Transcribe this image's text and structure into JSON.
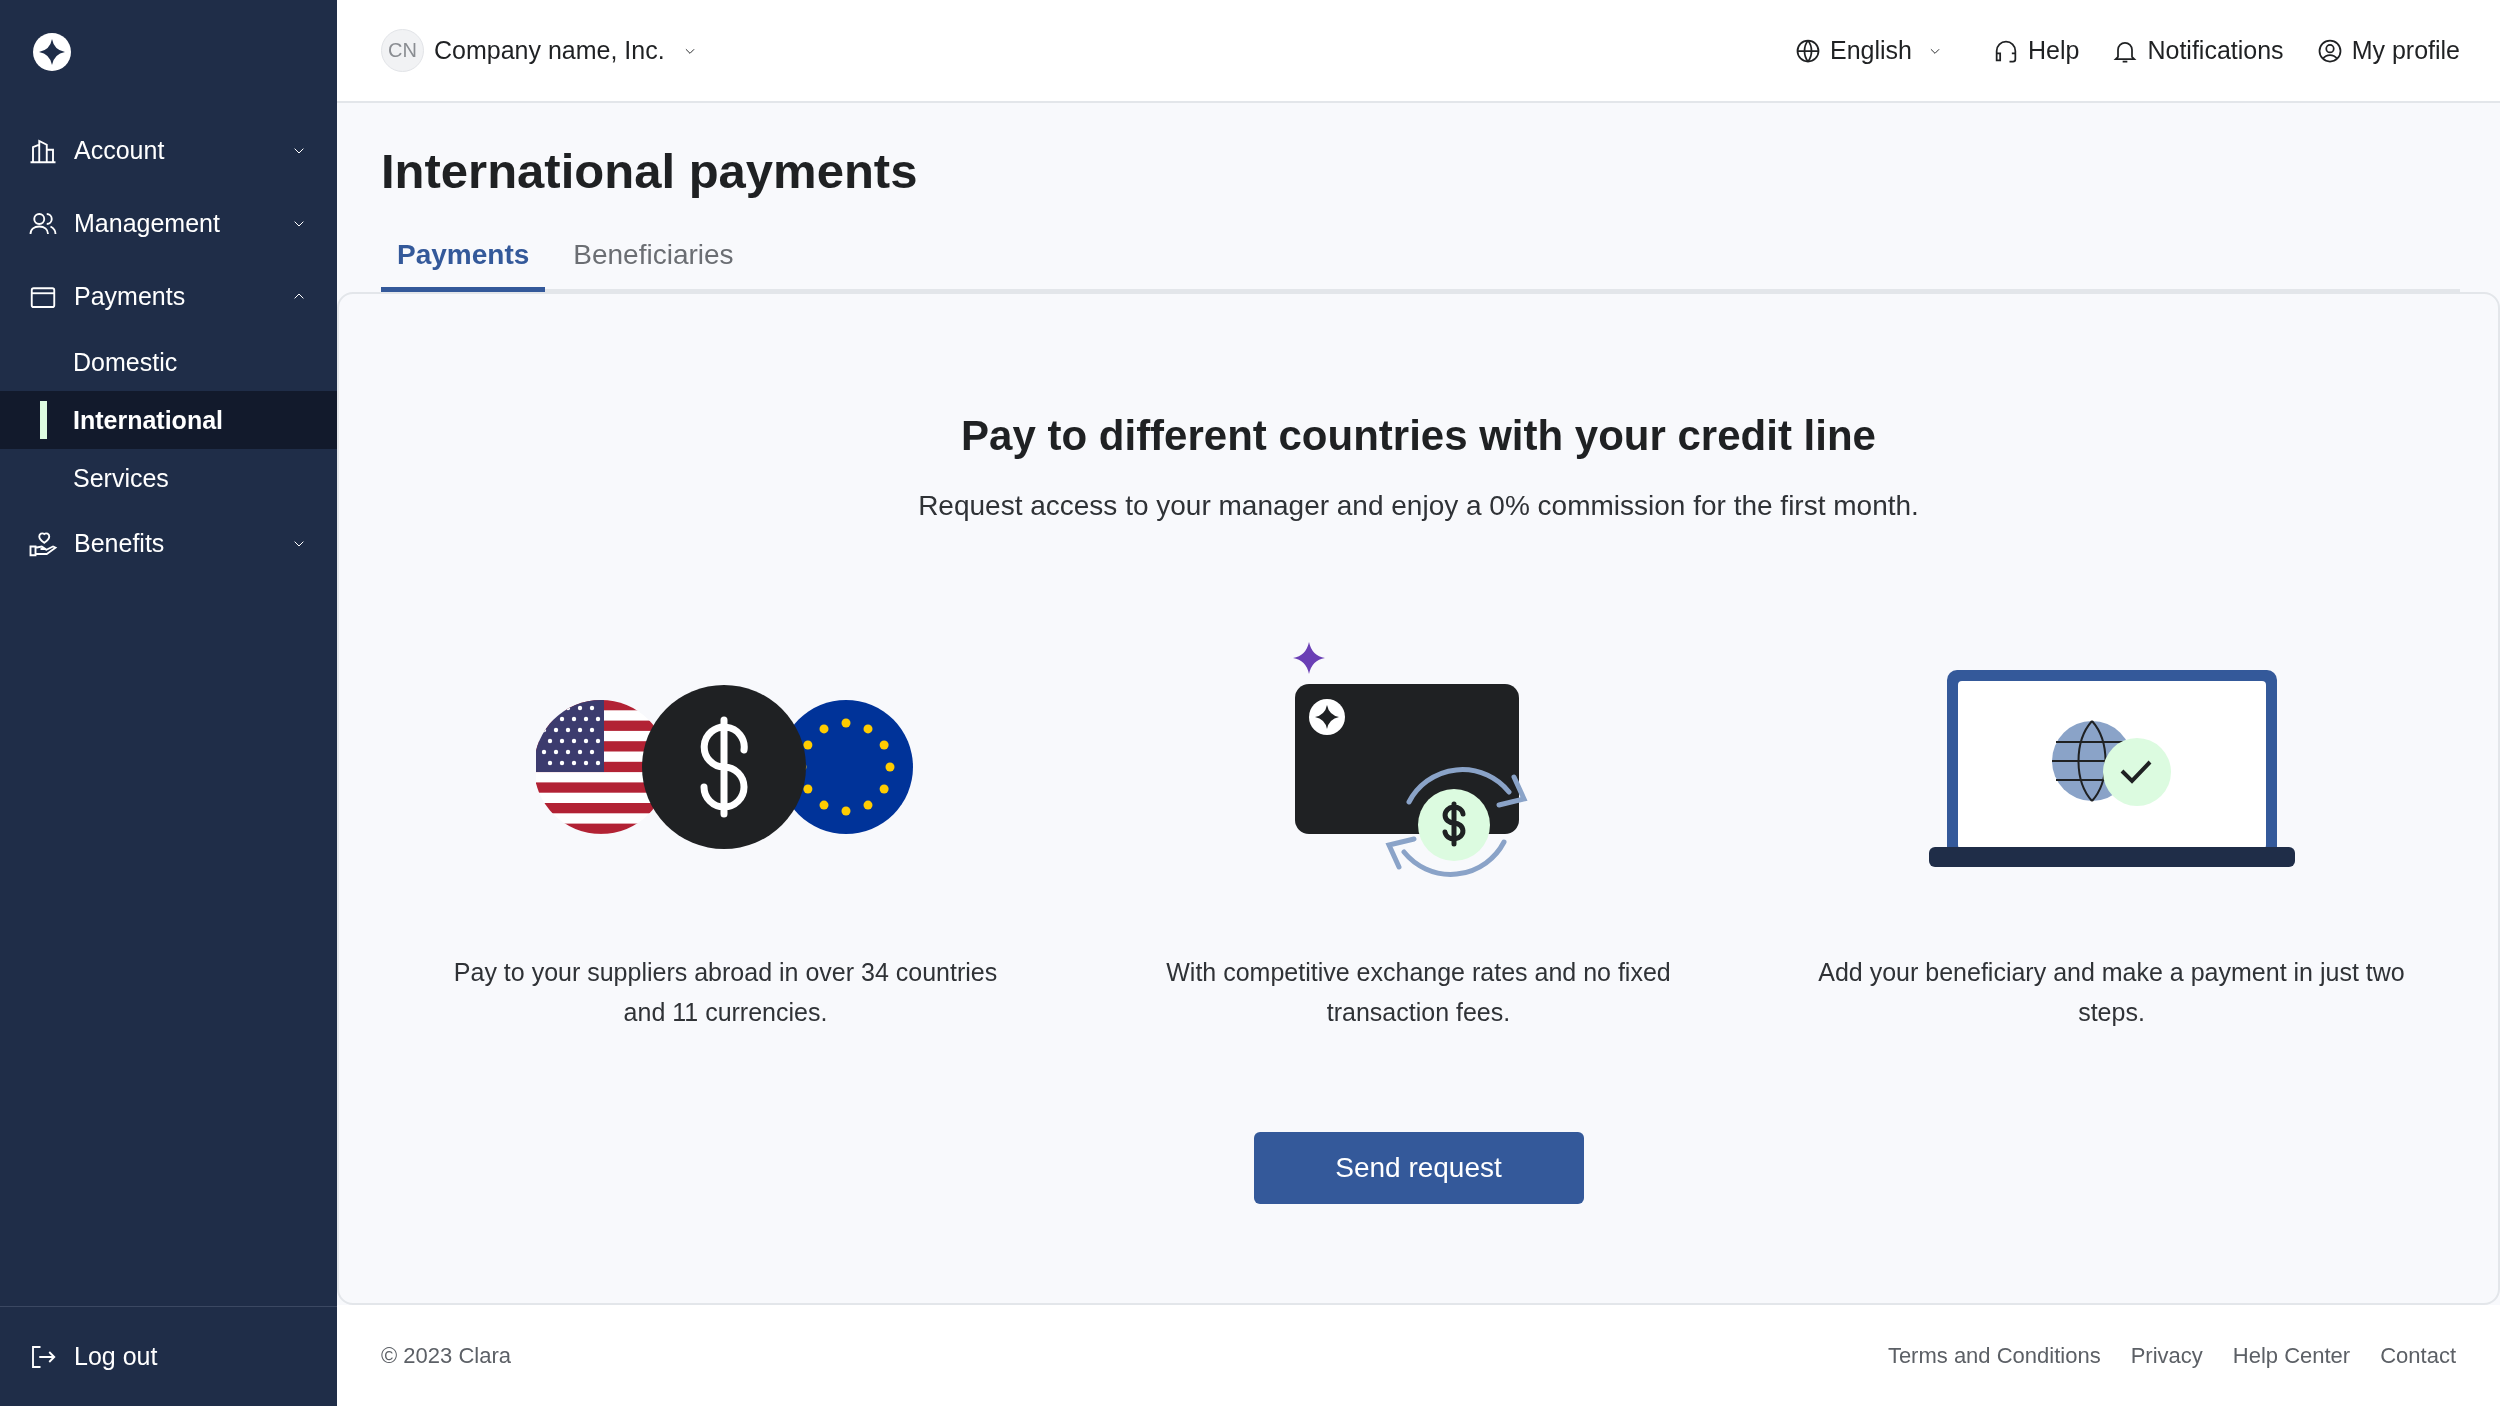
{
  "sidebar": {
    "items": [
      {
        "label": "Account",
        "expanded": false
      },
      {
        "label": "Management",
        "expanded": false
      },
      {
        "label": "Payments",
        "expanded": true,
        "children": [
          {
            "label": "Domestic",
            "selected": false
          },
          {
            "label": "International",
            "selected": true
          },
          {
            "label": "Services",
            "selected": false
          }
        ]
      },
      {
        "label": "Benefits",
        "expanded": false
      }
    ],
    "logout": "Log out"
  },
  "header": {
    "company": {
      "initials": "CN",
      "name": "Company name, Inc."
    },
    "language": "English",
    "actions": [
      "Help",
      "Notifications",
      "My profile"
    ]
  },
  "page": {
    "title": "International payments",
    "tabs": [
      {
        "label": "Payments",
        "selected": true
      },
      {
        "label": "Beneficiaries",
        "selected": false
      }
    ],
    "promo": {
      "heading": "Pay to different countries with your credit line",
      "subtitle": "Request access to your manager and enjoy a 0% commission for the first month.",
      "features": [
        "Pay to your suppliers abroad in over 34 countries and 11 currencies.",
        "With competitive exchange rates and no fixed transaction fees.",
        "Add your beneficiary and make a payment in just two steps."
      ],
      "button": "Send request"
    }
  },
  "footer": {
    "copyright": "© 2023 Clara",
    "links": [
      "Terms and Conditions",
      "Privacy",
      "Help Center",
      "Contact"
    ]
  }
}
